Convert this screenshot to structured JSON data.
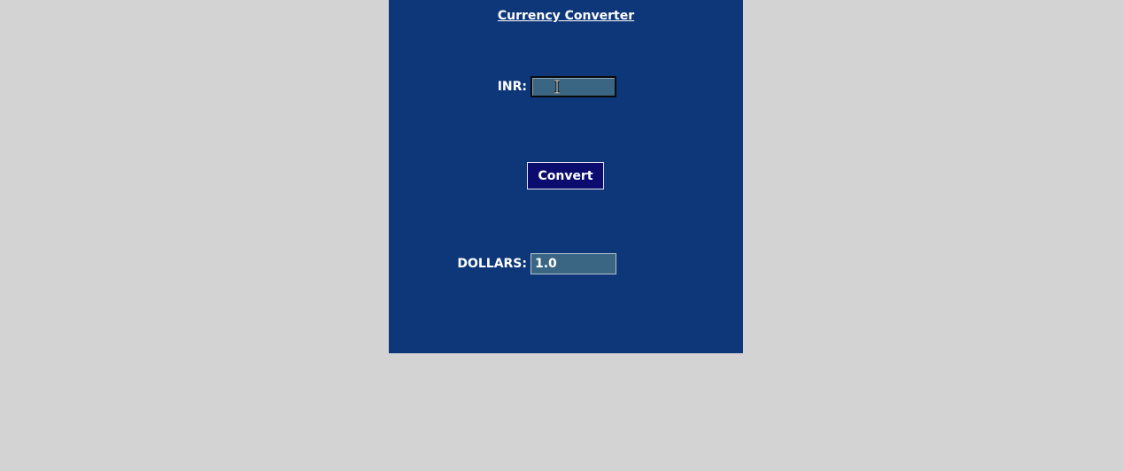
{
  "window": {
    "title": "Currency Converter"
  },
  "form": {
    "inr_label": "INR:",
    "inr_value": "",
    "convert_label": "Convert",
    "dollars_label": "DOLLARS:",
    "dollars_value": "1.0"
  },
  "colors": {
    "desktop_bg": "#d4d3d4",
    "window_bg": "#0e3779",
    "entry_bg": "#3a6683",
    "button_bg": "#0b0c6e",
    "text": "#ffffff"
  },
  "icons": {
    "cursor": "text-cursor-icon"
  }
}
